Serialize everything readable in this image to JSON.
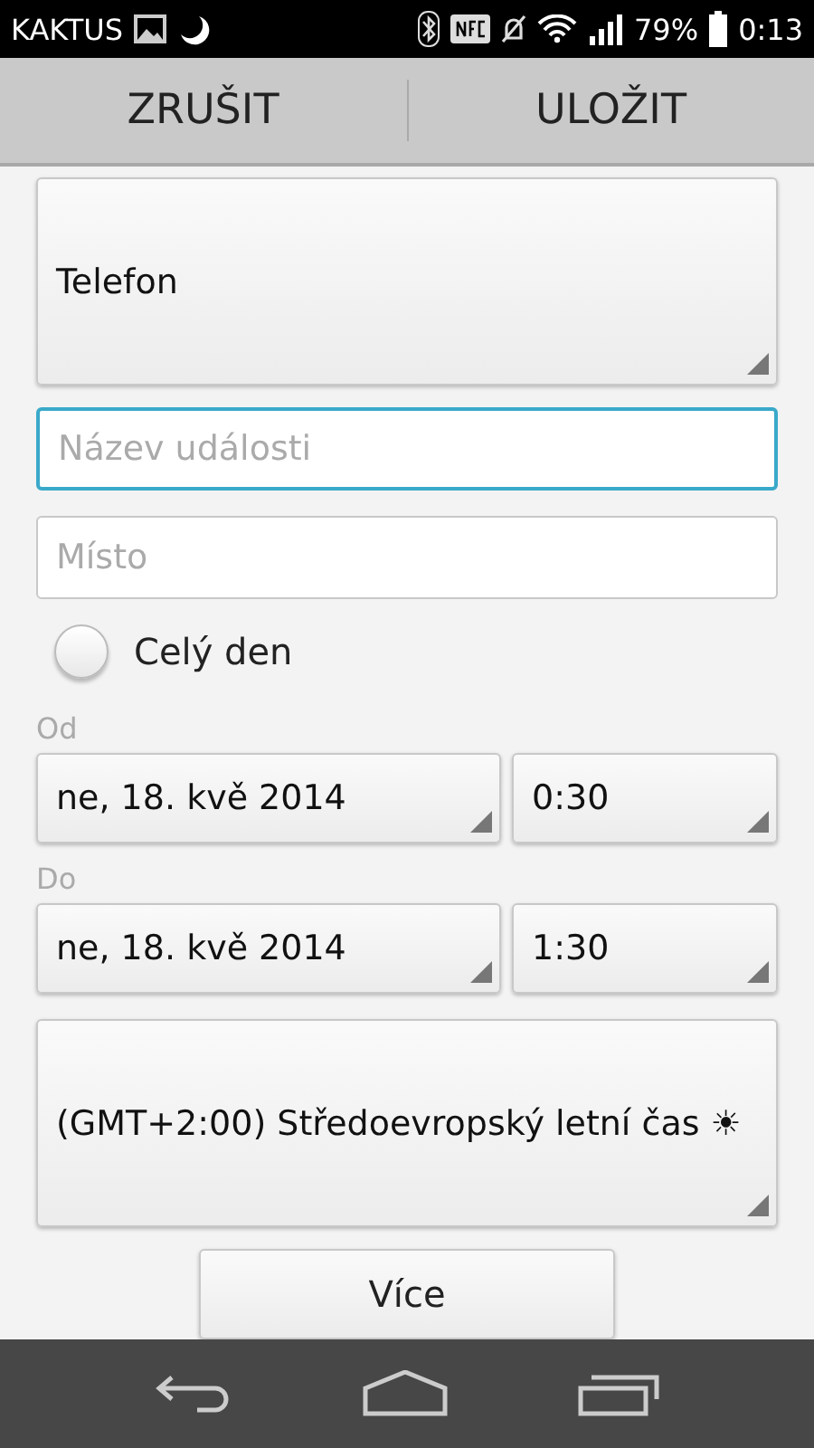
{
  "status_bar": {
    "carrier": "KAKTUS",
    "battery": "79%",
    "time": "0:13"
  },
  "action_bar": {
    "buttons": [
      "ZRUŠIT",
      "ULOŽIT"
    ]
  },
  "calendar_spinner": {
    "value": "Telefon"
  },
  "title_field": {
    "placeholder": "Název události",
    "focused": true
  },
  "location_field": {
    "placeholder": "Místo",
    "focused": false
  },
  "all_day": {
    "label": "Celý den",
    "checked": false
  },
  "from": {
    "label": "Od",
    "date": "ne, 18. kvě 2014",
    "time": "0:30"
  },
  "to": {
    "label": "Do",
    "date": "ne, 18. kvě 2014",
    "time": "1:30"
  },
  "timezone": {
    "value": "(GMT+2:00) Středoevropský letní čas ☀"
  },
  "more_button": {
    "label": "Více"
  }
}
